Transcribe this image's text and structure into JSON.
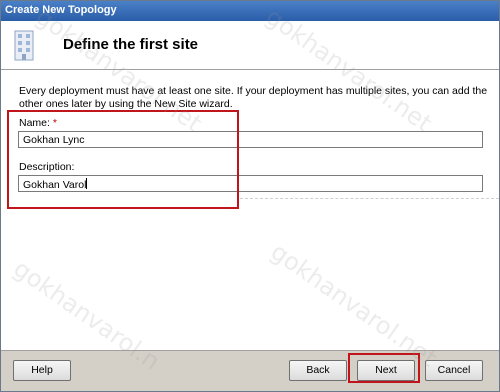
{
  "window": {
    "title": "Create New Topology"
  },
  "header": {
    "title": "Define the first site",
    "icon": "building-icon"
  },
  "content": {
    "intro": "Every deployment must have at least one site. If your deployment has multiple sites, you can add the other ones later by using the New Site wizard.",
    "name_label": "Name:",
    "required_mark": "*",
    "name_value": "Gokhan Lync",
    "description_label": "Description:",
    "description_value": "Gokhan Varol"
  },
  "footer": {
    "help_label": "Help",
    "back_label": "Back",
    "next_label": "Next",
    "cancel_label": "Cancel"
  },
  "watermark": {
    "text": "gokhanvarol.net",
    "text_alt": "gokhanvarol.n"
  },
  "colors": {
    "highlight": "#c0151a",
    "required": "#c00000",
    "titlebar": "#2a5ea8"
  }
}
